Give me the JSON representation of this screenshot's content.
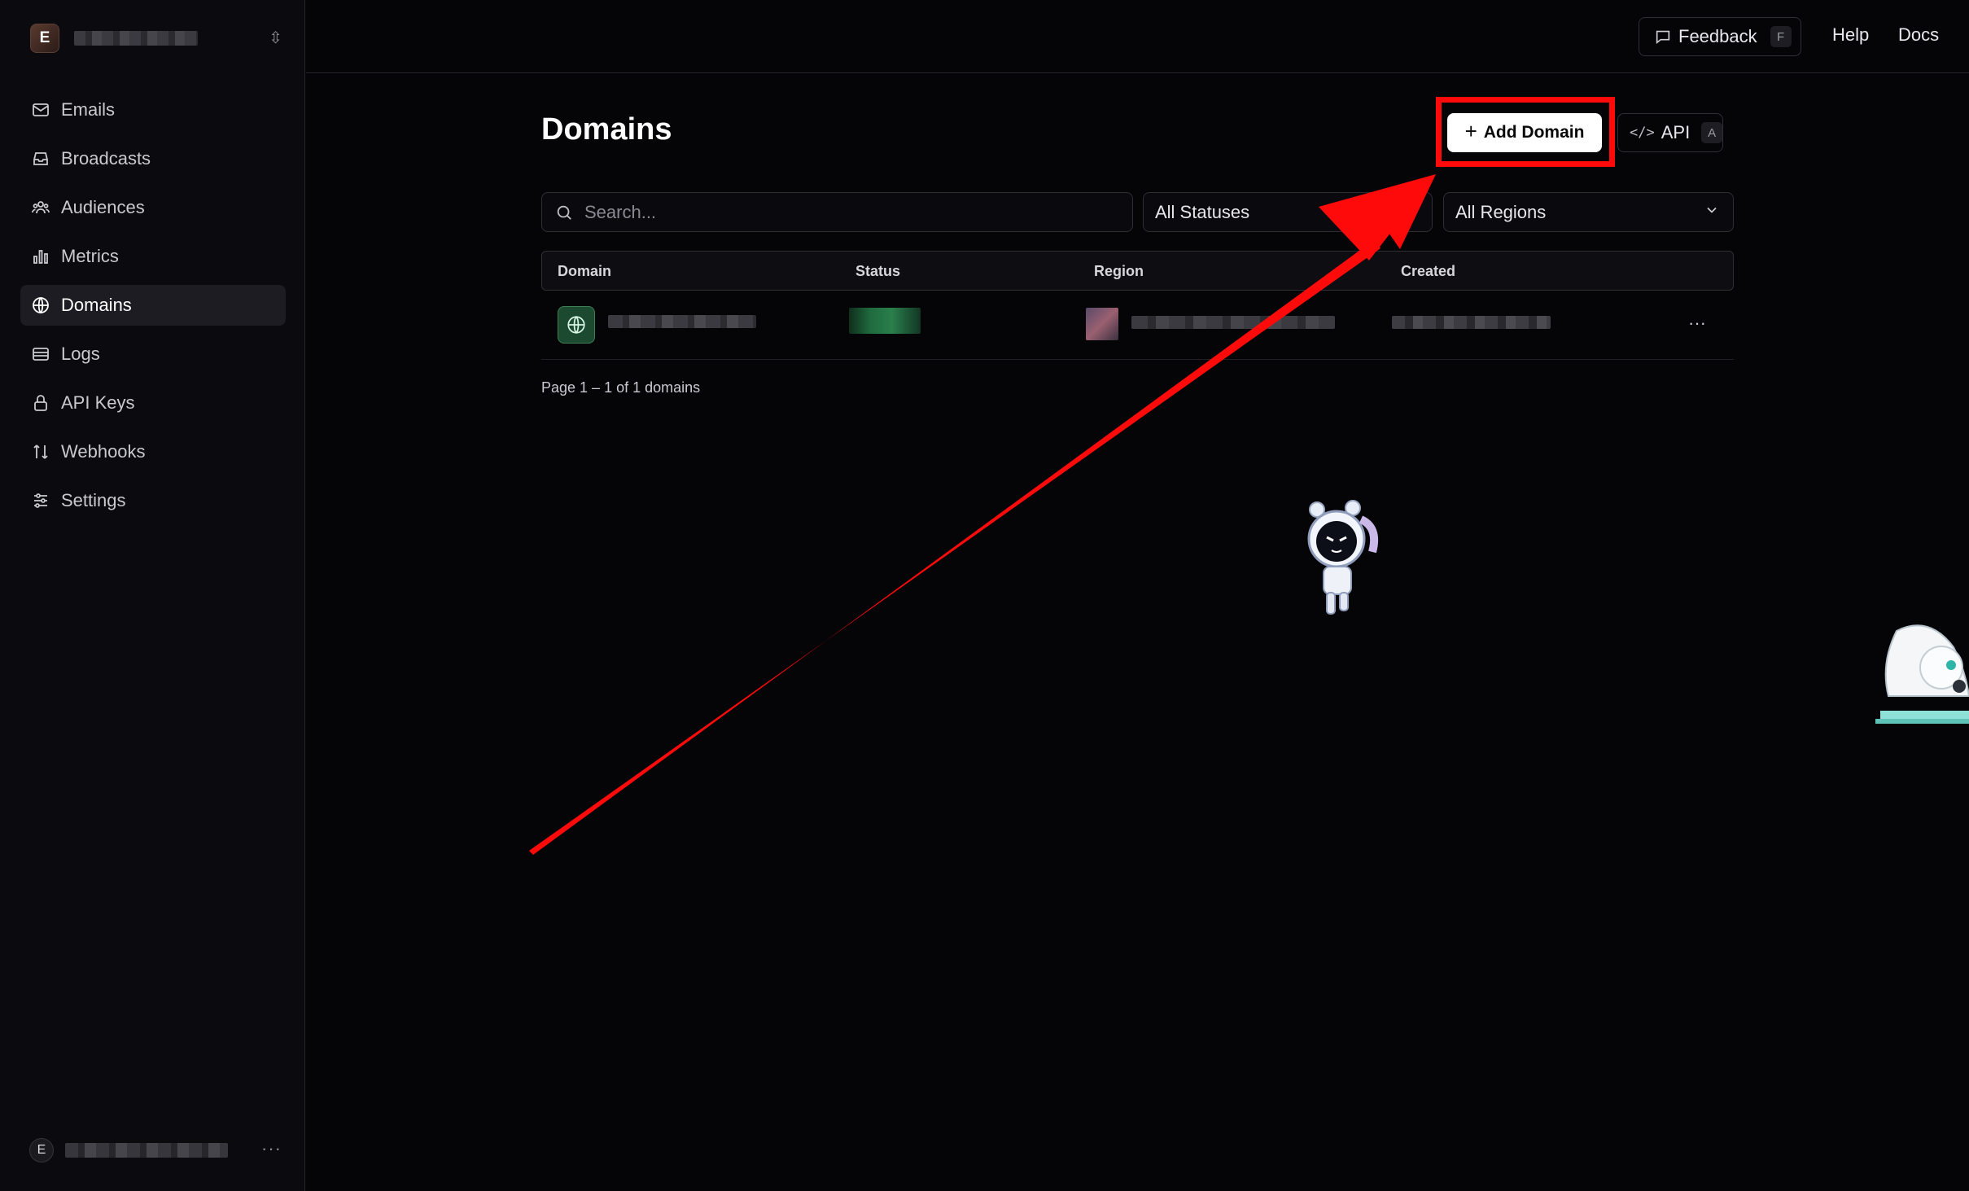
{
  "sidebar": {
    "workspace_initial": "E",
    "items": [
      {
        "label": "Emails"
      },
      {
        "label": "Broadcasts"
      },
      {
        "label": "Audiences"
      },
      {
        "label": "Metrics"
      },
      {
        "label": "Domains"
      },
      {
        "label": "Logs"
      },
      {
        "label": "API Keys"
      },
      {
        "label": "Webhooks"
      },
      {
        "label": "Settings"
      }
    ],
    "active_item": "Domains",
    "user_initial": "E",
    "user_more": "···"
  },
  "topbar": {
    "feedback_label": "Feedback",
    "feedback_shortcut": "F",
    "help_label": "Help",
    "docs_label": "Docs"
  },
  "main": {
    "title": "Domains",
    "add_domain_label": "Add Domain",
    "api_label": "API",
    "api_shortcut": "A",
    "search_placeholder": "Search...",
    "status_filter": "All Statuses",
    "region_filter": "All Regions",
    "columns": [
      "Domain",
      "Status",
      "Region",
      "Created"
    ],
    "row_more": "···",
    "pagination": "Page 1 – 1 of 1 domains"
  },
  "colors": {
    "background": "#050508",
    "sidebar": "#0b0b0f",
    "accent_green": "#1c4a30",
    "highlight_red": "#ff0a0a"
  },
  "icons": [
    "mail-icon",
    "inbox-icon",
    "users-icon",
    "bar-chart-icon",
    "globe-icon",
    "logs-icon",
    "lock-icon",
    "webhook-icon",
    "sliders-icon",
    "chat-icon",
    "code-icon",
    "search-icon",
    "chevron-down-icon",
    "plus-icon"
  ]
}
